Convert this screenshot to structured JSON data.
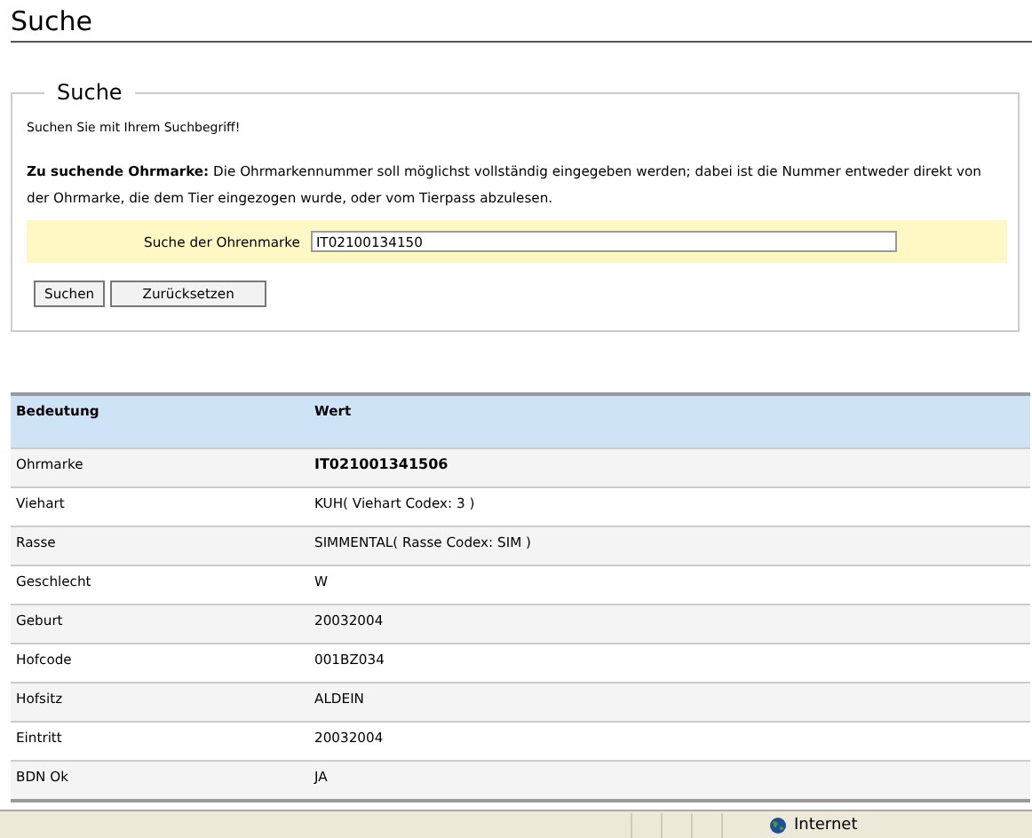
{
  "page_title": "Suche",
  "search_box": {
    "legend": "Suche",
    "intro": "Suchen Sie mit Ihrem Suchbegriff!",
    "hint": "**Zu suchende Ohrmarke:** Die Ohrmarkennummer soll möglichst vollständig eingegeben werden; dabei ist die Nummer entweder direkt von der Ohrmarke, die dem Tier eingezogen wurde, oder vom Tierpass abzulesen.",
    "field_label": "Suche der Ohrenmarke",
    "field_value": "IT02100134150",
    "buttons": [
      "Suchen",
      "Zurücksetzen"
    ]
  },
  "table": {
    "columns": [
      "Bedeutung",
      "Wert"
    ],
    "rows": [
      {
        "label": "Ohrmarke",
        "value": "IT021001341506",
        "emphasis": true
      },
      {
        "label": "Viehart",
        "value": "KUH( Viehart Codex: 3 )",
        "emphasis": false
      },
      {
        "label": "Rasse",
        "value": "SIMMENTAL( Rasse Codex: SIM )",
        "emphasis": false
      },
      {
        "label": "Geschlecht",
        "value": "W",
        "emphasis": false
      },
      {
        "label": "Geburt",
        "value": "20032004",
        "emphasis": false
      },
      {
        "label": "Hofcode",
        "value": "001BZ034",
        "emphasis": false
      },
      {
        "label": "Hofsitz",
        "value": "ALDEIN",
        "emphasis": false
      },
      {
        "label": "Eintritt",
        "value": "20032004",
        "emphasis": false
      },
      {
        "label": "BDN Ok",
        "value": "JA",
        "emphasis": false
      }
    ]
  },
  "status_bar": {
    "zone": "Internet"
  }
}
